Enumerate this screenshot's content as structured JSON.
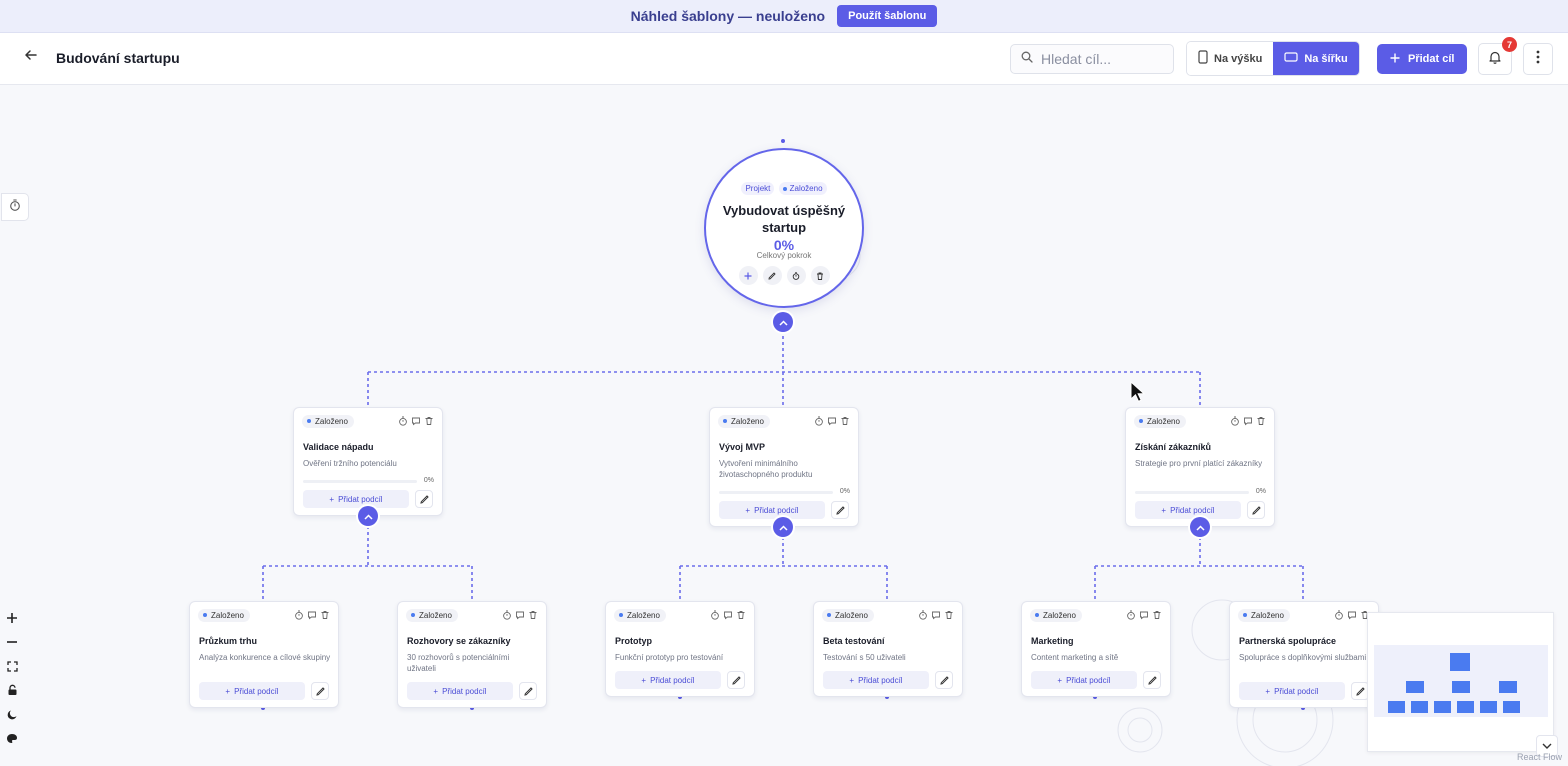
{
  "banner": {
    "text": "Náhled šablony — neuloženo",
    "button": "Použít šablonu"
  },
  "header": {
    "back_icon": "arrow-left-icon",
    "title": "Budování startupu",
    "search_placeholder": "Hledat cíl...",
    "view_portrait": "Na výšku",
    "view_landscape": "Na šířku",
    "add_goal": "Přidat cíl",
    "notification_count": "7"
  },
  "root": {
    "tag_type": "Projekt",
    "tag_status": "Založeno",
    "title": "Vybudovat úspěšný startup",
    "progress": "0%",
    "progress_label": "Celkový pokrok"
  },
  "nodes": [
    {
      "status": "Založeno",
      "title": "Validace nápadu",
      "desc": "Ověření tržního potenciálu",
      "progress": "0%",
      "add_label": "Přidat podcíl"
    },
    {
      "status": "Založeno",
      "title": "Vývoj MVP",
      "desc": "Vytvoření minimálního životaschopného produktu",
      "progress": "0%",
      "add_label": "Přidat podcíl"
    },
    {
      "status": "Založeno",
      "title": "Získání zákazníků",
      "desc": "Strategie pro první platící zákazníky",
      "progress": "0%",
      "add_label": "Přidat podcíl"
    },
    {
      "status": "Založeno",
      "title": "Průzkum trhu",
      "desc": "Analýza konkurence a cílové skupiny",
      "add_label": "Přidat podcíl"
    },
    {
      "status": "Založeno",
      "title": "Rozhovory se zákazníky",
      "desc": "30 rozhovorů s potenciálními uživateli",
      "add_label": "Přidat podcíl"
    },
    {
      "status": "Založeno",
      "title": "Prototyp",
      "desc": "Funkční prototyp pro testování",
      "add_label": "Přidat podcíl"
    },
    {
      "status": "Založeno",
      "title": "Beta testování",
      "desc": "Testování s 50 uživateli",
      "add_label": "Přidat podcíl"
    },
    {
      "status": "Založeno",
      "title": "Marketing",
      "desc": "Content marketing a sítě",
      "add_label": "Přidat podcíl"
    },
    {
      "status": "Založeno",
      "title": "Partnerská spolupráce",
      "desc": "Spolupráce s doplňkovými službami",
      "add_label": "Přidat podcíl"
    }
  ],
  "minimap_attribution": "React Flow",
  "colors": {
    "accent": "#5b5ce6",
    "status_dot": "#4a7bf0",
    "badge": "#e53935"
  }
}
